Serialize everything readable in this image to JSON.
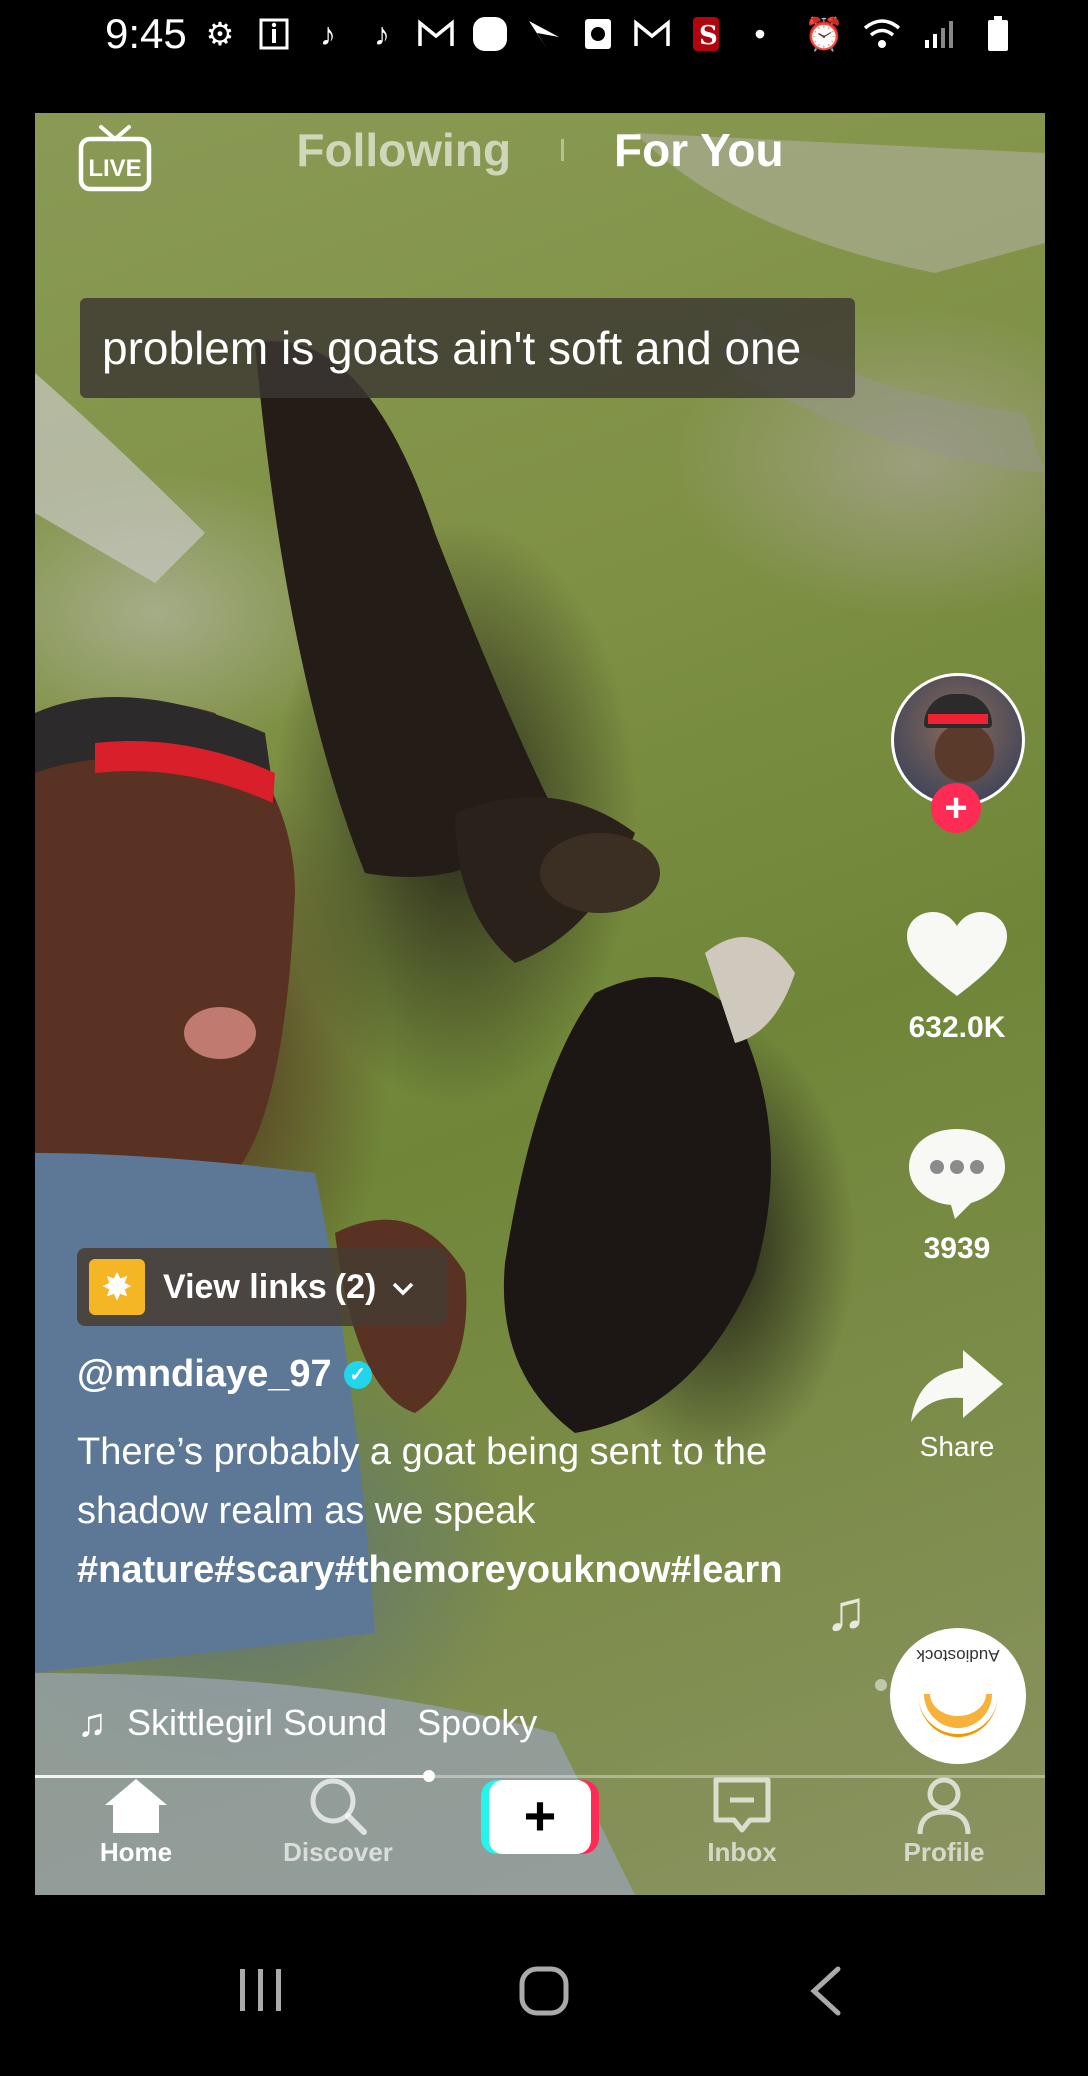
{
  "status_bar": {
    "time": "9:45"
  },
  "feed": {
    "live_label": "LIVE",
    "tabs": [
      {
        "label": "Following",
        "active": false
      },
      {
        "label": "For You",
        "active": true
      }
    ]
  },
  "video": {
    "caption": "problem is goats ain't soft and one"
  },
  "creator": {
    "username": "@mndiaye_97",
    "verified": true
  },
  "actions": {
    "likes": "632.0K",
    "comments": "3939",
    "share_label": "Share"
  },
  "links_button": {
    "label": "View links",
    "count": "(2)"
  },
  "description": {
    "text": "There’s probably a goat being sent to the shadow realm as we speak",
    "hashtags": "#nature#scary#themoreyouknow#learn"
  },
  "sound": {
    "text": "Skittlegirl Sound   Spooky"
  },
  "music_disc": {
    "brand": "Audiostock"
  },
  "playback": {
    "progress": 0.39
  },
  "bottom_nav": {
    "items": [
      {
        "label": "Home",
        "active": true
      },
      {
        "label": "Discover",
        "active": false
      },
      {
        "label": "",
        "active": false
      },
      {
        "label": "Inbox",
        "active": false
      },
      {
        "label": "Profile",
        "active": false
      }
    ]
  },
  "colors": {
    "accent_red": "#fe2c55",
    "accent_cyan": "#25f4ee",
    "verified_blue": "#20d5ec",
    "links_yellow": "#f5b625"
  }
}
